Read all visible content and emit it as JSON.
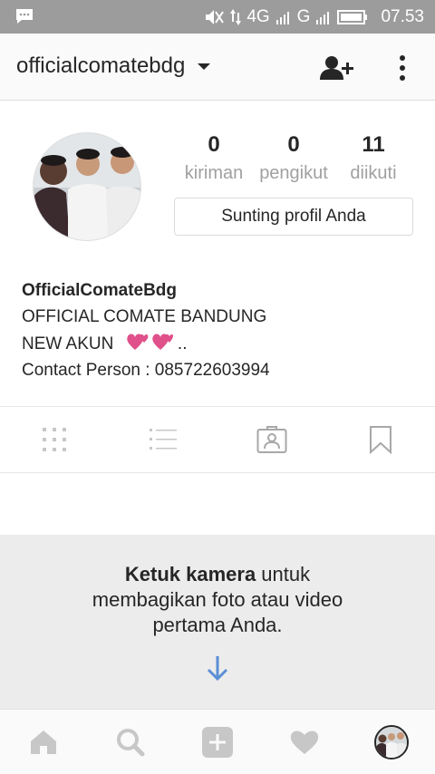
{
  "status_bar": {
    "network_primary": "4G",
    "network_secondary": "G",
    "time": "07.53"
  },
  "header": {
    "username": "officialcomatebdg"
  },
  "profile": {
    "stats": [
      {
        "value": "0",
        "label": "kiriman"
      },
      {
        "value": "0",
        "label": "pengikut"
      },
      {
        "value": "11",
        "label": "diikuti"
      }
    ],
    "edit_button": "Sunting profil Anda",
    "bio": {
      "name": "OfficialComateBdg",
      "line1": "OFFICIAL COMATE BANDUNG",
      "line2_text": "NEW AKUN",
      "line2_suffix": " ..",
      "line3": "Contact Person : 085722603994"
    }
  },
  "empty_state": {
    "bold": "Ketuk kamera",
    "rest1": " untuk",
    "line2": "membagikan foto atau video",
    "line3": "pertama Anda."
  },
  "colors": {
    "status_bar": "#9c9c9c",
    "accent_arrow": "#5b8fd6",
    "icon_gray": "#c7c7c7",
    "heart_pink": "#e0508a"
  },
  "icons": {
    "tabs": [
      "grid-icon",
      "list-icon",
      "tagged-person-icon",
      "bookmark-icon"
    ],
    "nav": [
      "home-icon",
      "search-icon",
      "add-post-icon",
      "heart-icon",
      "profile-avatar"
    ]
  }
}
